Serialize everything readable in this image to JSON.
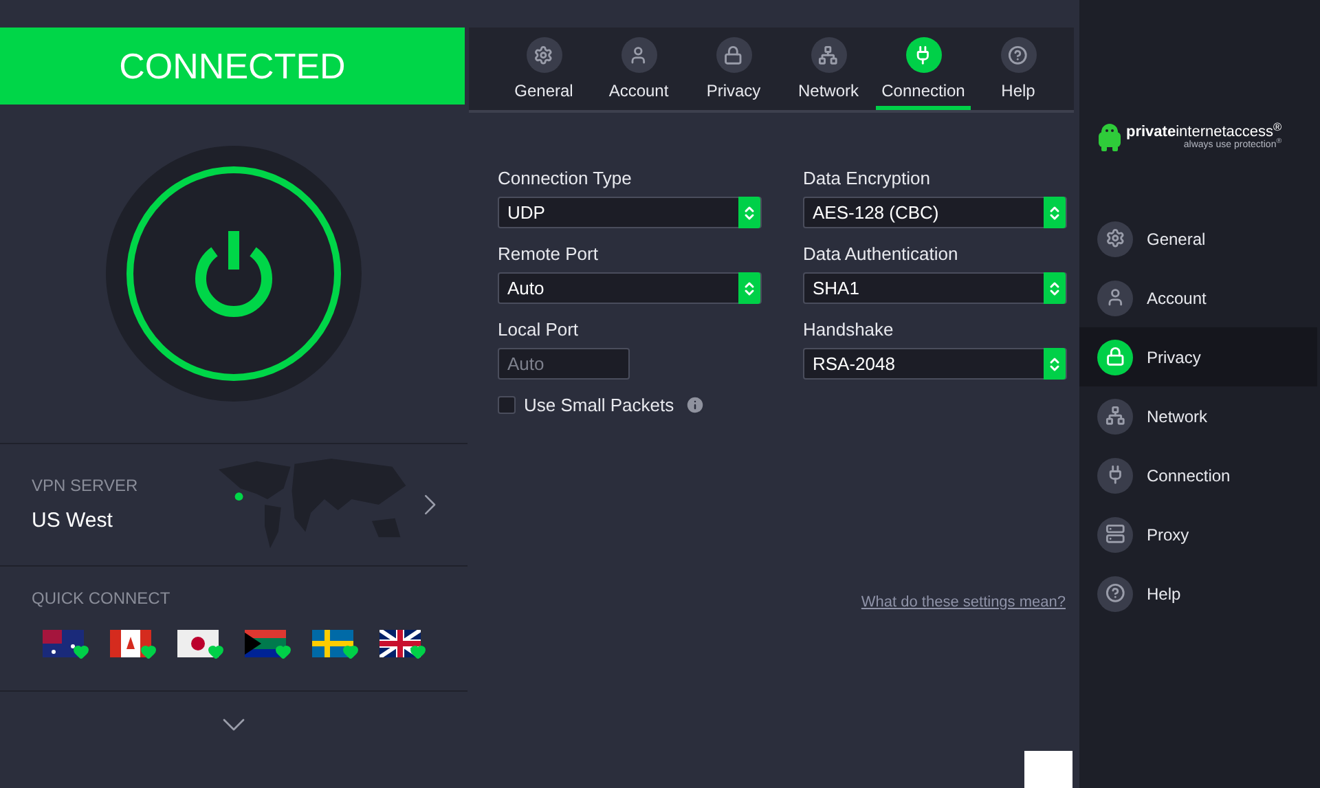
{
  "status": {
    "text": "CONNECTED",
    "connected": true
  },
  "vpn_server": {
    "label": "VPN SERVER",
    "name": "US West"
  },
  "quick_connect": {
    "label": "QUICK CONNECT",
    "flags": [
      {
        "kind": "australia"
      },
      {
        "kind": "canada"
      },
      {
        "kind": "japan"
      },
      {
        "kind": "southafrica"
      },
      {
        "kind": "sweden"
      },
      {
        "kind": "uk"
      }
    ]
  },
  "tabs": [
    {
      "label": "General",
      "kind": "general",
      "selected": false
    },
    {
      "label": "Account",
      "kind": "account",
      "selected": false
    },
    {
      "label": "Privacy",
      "kind": "privacy",
      "selected": false
    },
    {
      "label": "Network",
      "kind": "network",
      "selected": false
    },
    {
      "label": "Connection",
      "kind": "connection",
      "selected": true
    },
    {
      "label": "Help",
      "kind": "help",
      "selected": false
    }
  ],
  "left_fields": [
    {
      "kind": "select",
      "label": "Connection Type",
      "value": "UDP"
    },
    {
      "kind": "select",
      "label": "Remote Port",
      "value": "Auto"
    },
    {
      "kind": "input",
      "label": "Local Port",
      "placeholder": "Auto"
    }
  ],
  "right_fields": [
    {
      "kind": "select",
      "label": "Data Encryption",
      "value": "AES-128 (CBC)"
    },
    {
      "kind": "select",
      "label": "Data Authentication",
      "value": "SHA1"
    },
    {
      "kind": "select",
      "label": "Handshake",
      "value": "RSA-2048"
    }
  ],
  "small_packets": {
    "label": "Use Small Packets",
    "checked": false
  },
  "help_link": "What do these settings mean?",
  "sidebar": {
    "logo": "**private**internetaccess$^{®}$",
    "tagline": "always use protection$^{®}$",
    "items": [
      {
        "label": "General",
        "kind": "general",
        "selected": false
      },
      {
        "label": "Account",
        "kind": "account",
        "selected": false
      },
      {
        "label": "Privacy",
        "kind": "privacy",
        "selected": true
      },
      {
        "label": "Network",
        "kind": "network",
        "selected": false
      },
      {
        "label": "Connection",
        "kind": "connection",
        "selected": false
      },
      {
        "label": "Proxy",
        "kind": "proxy",
        "selected": false
      },
      {
        "label": "Help",
        "kind": "help",
        "selected": false
      }
    ]
  }
}
